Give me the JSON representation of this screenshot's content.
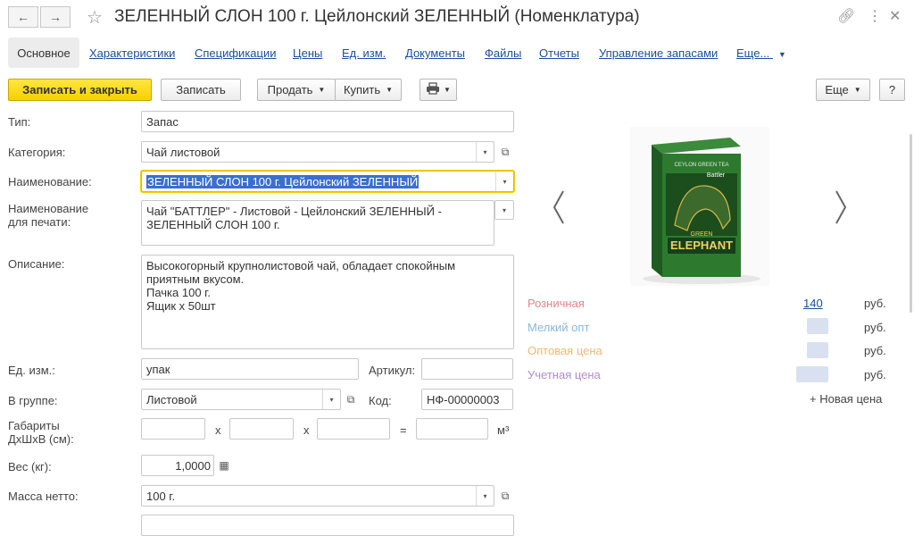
{
  "window": {
    "title": "ЗЕЛЕННЫЙ СЛОН 100 г. Цейлонский ЗЕЛЕННЫЙ (Номенклатура)"
  },
  "colors": {
    "primary_button": "#f5d100",
    "link": "#1a4f9c",
    "retail": "#e8838a",
    "small_wholesale": "#87b7e0",
    "wholesale": "#f0b870",
    "account": "#b08ad0"
  },
  "icons": [
    "back-arrow-icon",
    "forward-arrow-icon",
    "star-icon",
    "link-icon",
    "kebab-menu-icon",
    "close-icon",
    "print-icon",
    "calendar-icon",
    "open-icon",
    "chevron-left-icon",
    "chevron-right-icon"
  ],
  "tabs": [
    {
      "label": "Основное"
    },
    {
      "label": "Характеристики"
    },
    {
      "label": "Спецификации"
    },
    {
      "label": "Цены"
    },
    {
      "label": "Ед. изм."
    },
    {
      "label": "Документы"
    },
    {
      "label": "Файлы"
    },
    {
      "label": "Отчеты"
    },
    {
      "label": "Управление запасами"
    },
    {
      "label": "Еще..."
    }
  ],
  "toolbar": {
    "save_close": "Записать и закрыть",
    "save": "Записать",
    "sell": "Продать",
    "buy": "Купить",
    "more": "Еще",
    "help": "?"
  },
  "form": {
    "type": {
      "label": "Тип:",
      "value": "Запас"
    },
    "category": {
      "label": "Категория:",
      "value": "Чай листовой"
    },
    "name": {
      "label": "Наименование:",
      "value": "ЗЕЛЕННЫЙ СЛОН 100 г. Цейлонский ЗЕЛЕННЫЙ"
    },
    "print_name": {
      "label": "Наименование для печати:",
      "line1": "Чай \"БАТТЛЕР\" - Листовой - Цейлонский ЗЕЛЕННЫЙ  -",
      "line2": "ЗЕЛЕННЫЙ СЛОН 100 г."
    },
    "description": {
      "label": "Описание:",
      "lines": [
        "Высокогорный крупнолистовой чай, обладает спокойным",
        "приятным вкусом.",
        "Пачка 100 г.",
        "Ящик х 50шт"
      ]
    },
    "unit": {
      "label": "Ед. изм.:",
      "value": "упак"
    },
    "article": {
      "label": "Артикул:",
      "value": ""
    },
    "group": {
      "label": "В группе:",
      "value": "Листовой"
    },
    "code": {
      "label": "Код:",
      "value": "НФ-00000003"
    },
    "dimensions": {
      "label_line1": "Габариты",
      "label_line2": "ДхШхВ (см):",
      "x1": "х",
      "x2": "х",
      "eq": "=",
      "unit": "м³"
    },
    "weight": {
      "label": "Вес (кг):",
      "value": "1,0000"
    },
    "net_mass": {
      "label": "Масса нетто:",
      "value": "100 г."
    }
  },
  "image": {
    "brand_top": "CEYLON GREEN TEA",
    "brand": "Battler",
    "product": "GREEN",
    "product2": "ELEPHANT"
  },
  "prices": [
    {
      "label": "Розничная",
      "value": "140",
      "currency": "руб."
    },
    {
      "label": "Мелкий опт",
      "value": "",
      "currency": "руб."
    },
    {
      "label": "Оптовая цена",
      "value": "",
      "currency": "руб."
    },
    {
      "label": "Учетная цена",
      "value": "",
      "currency": "руб."
    }
  ],
  "new_price": "+ Новая цена"
}
